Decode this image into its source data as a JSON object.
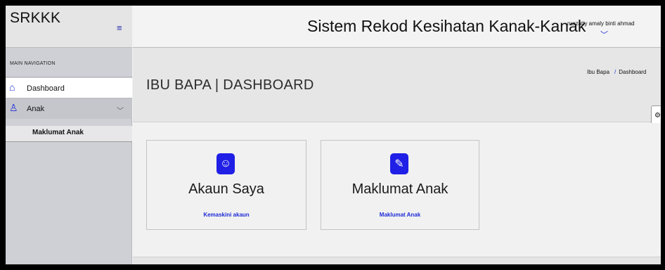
{
  "sidebar": {
    "brand": "SRKKK",
    "menu_toggle_icon": "≡",
    "section_header": "MAIN NAVIGATION",
    "items": [
      {
        "label": "Dashboard",
        "icon": "home-icon",
        "glyph": "⌂"
      },
      {
        "label": "Anak",
        "icon": "user-icon",
        "glyph": "♙",
        "chevron": "﹀"
      }
    ],
    "sub_items": [
      {
        "label": "Maklumat Anak"
      }
    ]
  },
  "header": {
    "title": "Sistem Rekod Kesihatan Kanak-Kanak",
    "user_name": "nurzatty amaly binti ahmad",
    "user_chevron": "﹀"
  },
  "page": {
    "title": "IBU BAPA | DASHBOARD",
    "breadcrumb": [
      "Ibu Bapa",
      "Dashboard"
    ],
    "breadcrumb_separator": "/",
    "settings_icon": "gear-icon",
    "settings_glyph": "⚙"
  },
  "cards": [
    {
      "title": "Akaun Saya",
      "link": "Kemaskini akaun",
      "icon": "smile-icon",
      "glyph": "☺"
    },
    {
      "title": "Maklumat Anak",
      "link": "Maklumat Anak",
      "icon": "paperclip-icon",
      "glyph": "✎"
    }
  ],
  "colors": {
    "accent": "#1f1fe6",
    "link": "#1d2bd6",
    "sidebar_bg": "#cfd0d6"
  }
}
